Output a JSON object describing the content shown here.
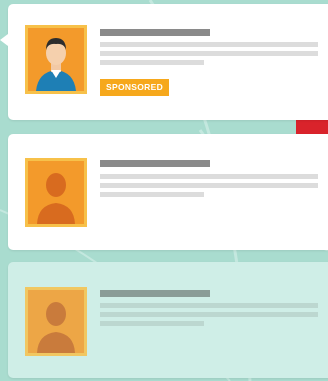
{
  "feed": {
    "items": [
      {
        "type": "sponsored",
        "badge": "SPONSORED",
        "avatar": "man-avatar-icon"
      },
      {
        "type": "post",
        "avatar": "person-silhouette-icon"
      },
      {
        "type": "post",
        "avatar": "person-silhouette-icon"
      }
    ]
  },
  "colors": {
    "background": "#a9dccf",
    "badge": "#f6a81c",
    "avatar_bg": "#f39a2b",
    "avatar_border": "#f7c14a",
    "accent_red": "#d9232b"
  }
}
